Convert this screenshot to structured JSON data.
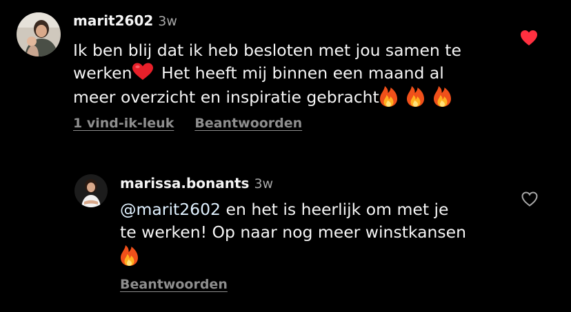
{
  "comment": {
    "username": "marit2602",
    "time": "3w",
    "text_lines": [
      "Ik ben blij dat ik heb besloten met jou samen te",
      "werken",
      "Het heeft mij binnen een maand al",
      "meer overzicht en inspiratie gebracht"
    ],
    "emojis": [
      "red-heart",
      "fire",
      "fire",
      "fire"
    ],
    "likes_label": "1 vind-ik-leuk",
    "reply_label": "Beantwoorden",
    "liked": true
  },
  "reply": {
    "username": "marissa.bonants",
    "time": "3w",
    "mention": "@marit2602",
    "text_lines": [
      "en het is heerlijk om met je",
      "te werken! Op naar nog meer winstkansen"
    ],
    "emojis": [
      "fire"
    ],
    "reply_label": "Beantwoorden",
    "liked": false
  },
  "colors": {
    "background": "#000000",
    "text": "#f5f5f5",
    "secondary_text": "#a8a8a8",
    "action_text": "#8e8e8e",
    "like_red": "#ff3040"
  }
}
